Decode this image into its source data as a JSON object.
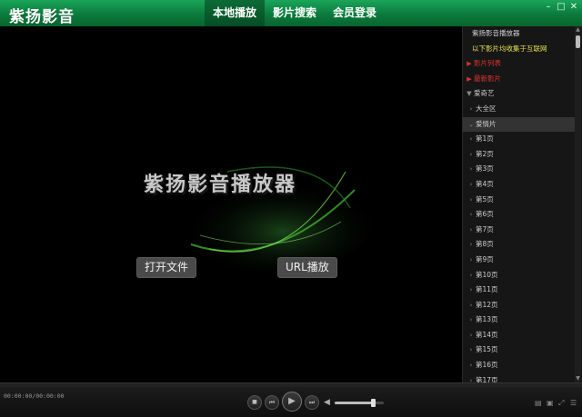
{
  "app": {
    "title": "紫扬影音"
  },
  "nav": {
    "tabs": [
      "本地播放",
      "影片搜索",
      "会员登录"
    ],
    "active_index": 0
  },
  "window_controls": {
    "minimize": "–",
    "maximize": "□",
    "close": "✕"
  },
  "video": {
    "brand_text": "紫扬影音播放器",
    "open_file_label": "打开文件",
    "url_play_label": "URL播放"
  },
  "sidebar": {
    "items": [
      {
        "label": "紫扬影音播放器",
        "arrow": "",
        "color": "#d0d0d0"
      },
      {
        "label": "以下影片均收集于互联网",
        "arrow": "",
        "color": "#e8e04a"
      },
      {
        "label": "影片列表",
        "arrow": "▶",
        "color": "#e03030"
      },
      {
        "label": "最新影片",
        "arrow": "▶",
        "color": "#e03030"
      },
      {
        "label": "爱奇艺",
        "arrow": "▼",
        "color": "#cfcfcf"
      },
      {
        "label": "大全区",
        "arrow": "›",
        "color": "#cfcfcf",
        "indent": true
      },
      {
        "label": "爱情片",
        "arrow": "⌄",
        "color": "#cfcfcf",
        "indent": true,
        "selected": true
      },
      {
        "label": "第1页",
        "arrow": "›",
        "color": "#cfcfcf",
        "indent": true
      },
      {
        "label": "第2页",
        "arrow": "›",
        "color": "#cfcfcf",
        "indent": true
      },
      {
        "label": "第3页",
        "arrow": "›",
        "color": "#cfcfcf",
        "indent": true
      },
      {
        "label": "第4页",
        "arrow": "›",
        "color": "#cfcfcf",
        "indent": true
      },
      {
        "label": "第5页",
        "arrow": "›",
        "color": "#cfcfcf",
        "indent": true
      },
      {
        "label": "第6页",
        "arrow": "›",
        "color": "#cfcfcf",
        "indent": true
      },
      {
        "label": "第7页",
        "arrow": "›",
        "color": "#cfcfcf",
        "indent": true
      },
      {
        "label": "第8页",
        "arrow": "›",
        "color": "#cfcfcf",
        "indent": true
      },
      {
        "label": "第9页",
        "arrow": "›",
        "color": "#cfcfcf",
        "indent": true
      },
      {
        "label": "第10页",
        "arrow": "›",
        "color": "#cfcfcf",
        "indent": true
      },
      {
        "label": "第11页",
        "arrow": "›",
        "color": "#cfcfcf",
        "indent": true
      },
      {
        "label": "第12页",
        "arrow": "›",
        "color": "#cfcfcf",
        "indent": true
      },
      {
        "label": "第13页",
        "arrow": "›",
        "color": "#cfcfcf",
        "indent": true
      },
      {
        "label": "第14页",
        "arrow": "›",
        "color": "#cfcfcf",
        "indent": true
      },
      {
        "label": "第15页",
        "arrow": "›",
        "color": "#cfcfcf",
        "indent": true
      },
      {
        "label": "第16页",
        "arrow": "›",
        "color": "#cfcfcf",
        "indent": true
      },
      {
        "label": "第17页",
        "arrow": "›",
        "color": "#cfcfcf",
        "indent": true
      }
    ]
  },
  "player": {
    "time": "00:00:00/00:00:00",
    "volume": 0.8,
    "buttons": {
      "stop": "■",
      "prev": "⏮",
      "play": "▶",
      "next": "⏭",
      "volume_icon": "◀"
    }
  },
  "colors": {
    "accent": "#0b7a3c",
    "sidebar_bg": "#161616"
  }
}
